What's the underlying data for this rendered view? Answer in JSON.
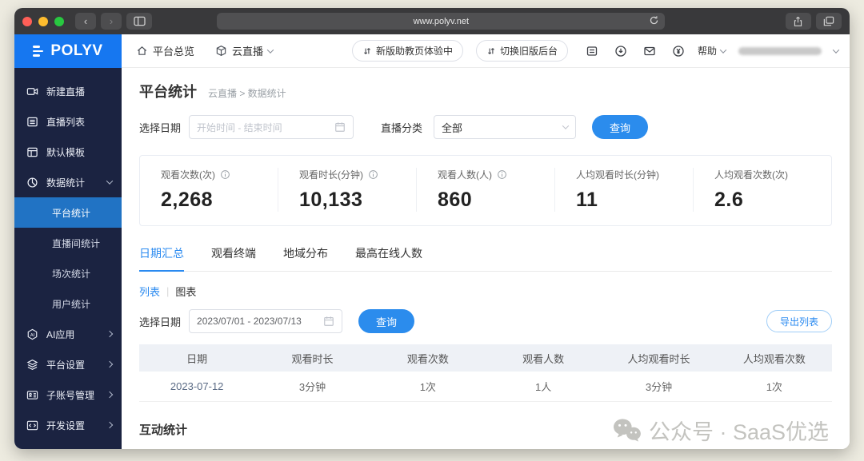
{
  "browser": {
    "url": "www.polyv.net"
  },
  "app": {
    "logo": "POLYV"
  },
  "topnav": {
    "overview": "平台总览",
    "product": "云直播"
  },
  "header_actions": {
    "pill_new": "新版助教页体验中",
    "pill_old": "切换旧版后台",
    "help": "帮助"
  },
  "sidebar": {
    "items": [
      {
        "label": "新建直播"
      },
      {
        "label": "直播列表"
      },
      {
        "label": "默认模板"
      },
      {
        "label": "数据统计"
      }
    ],
    "subitems": [
      {
        "label": "平台统计"
      },
      {
        "label": "直播间统计"
      },
      {
        "label": "场次统计"
      },
      {
        "label": "用户统计"
      }
    ],
    "groups": [
      {
        "label": "AI应用"
      },
      {
        "label": "平台设置"
      },
      {
        "label": "子账号管理"
      },
      {
        "label": "开发设置"
      }
    ]
  },
  "page": {
    "title": "平台统计",
    "breadcrumb": "云直播 > 数据统计"
  },
  "filters": {
    "date_label": "选择日期",
    "date_placeholder": "开始时间 - 结束时间",
    "category_label": "直播分类",
    "category_value": "全部",
    "query": "查询"
  },
  "stats": [
    {
      "label": "观看次数(次)",
      "value": "2,268"
    },
    {
      "label": "观看时长(分钟)",
      "value": "10,133"
    },
    {
      "label": "观看人数(人)",
      "value": "860"
    },
    {
      "label": "人均观看时长(分钟)",
      "value": "11"
    },
    {
      "label": "人均观看次数(次)",
      "value": "2.6"
    }
  ],
  "tabs": [
    {
      "label": "日期汇总"
    },
    {
      "label": "观看终端"
    },
    {
      "label": "地域分布"
    },
    {
      "label": "最高在线人数"
    }
  ],
  "view_toggle": {
    "list": "列表",
    "chart": "图表"
  },
  "date_query": {
    "label": "选择日期",
    "value": "2023/07/01 - 2023/07/13",
    "query": "查询",
    "export": "导出列表"
  },
  "table": {
    "headers": [
      "日期",
      "观看时长",
      "观看次数",
      "观看人数",
      "人均观看时长",
      "人均观看次数"
    ],
    "rows": [
      [
        "2023-07-12",
        "3分钟",
        "1次",
        "1人",
        "3分钟",
        "1次"
      ]
    ]
  },
  "sections": {
    "interaction": "互动统计"
  },
  "watermark": {
    "text": "公众号 · SaaS优选"
  },
  "colors": {
    "accent": "#2b8ced",
    "tab_active": "#2a8af0",
    "logo_blue": "#1677f0",
    "sidebar_bg": "#1b2341",
    "sidebar_active": "#2173c4",
    "table_header_bg": "#eef1f6"
  }
}
